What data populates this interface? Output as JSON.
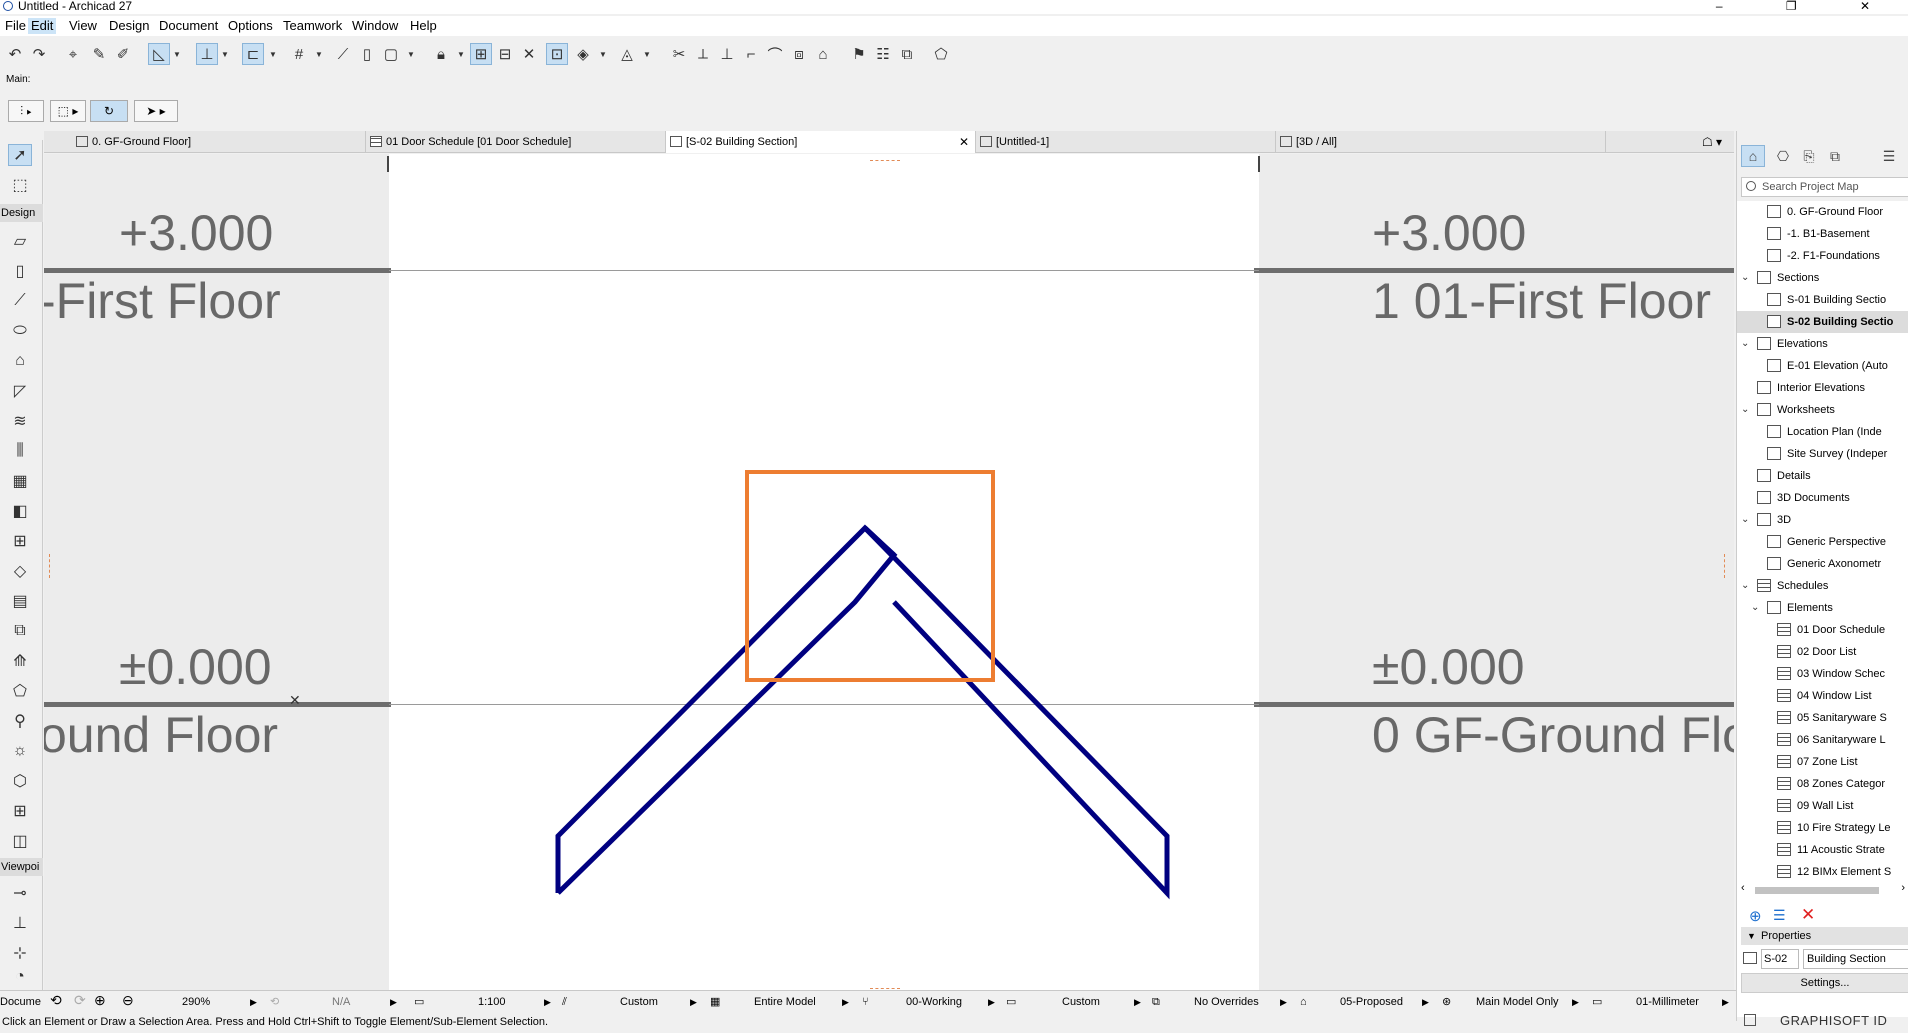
{
  "window": {
    "title": "Untitled - Archicad 27",
    "controls": "– ❐ ✕"
  },
  "menu": [
    "File",
    "Edit",
    "View",
    "Design",
    "Document",
    "Options",
    "Teamwork",
    "Window",
    "Help"
  ],
  "main_label": "Main:",
  "tabs": [
    {
      "label": "0. GF-Ground Floor]",
      "icon": "floorplan-icon"
    },
    {
      "label": "01 Door Schedule [01 Door Schedule]",
      "icon": "schedule-icon"
    },
    {
      "label": "[S-02 Building Section]",
      "icon": "section-icon",
      "close": "✕"
    },
    {
      "label": "[Untitled-1]",
      "icon": "layout-icon"
    },
    {
      "label": "[3D / All]",
      "icon": "3d-icon"
    }
  ],
  "left_toolbox": {
    "design_label": "Design",
    "viewpoint_label": "Viewpoi",
    "document_label": "Docume"
  },
  "canvas": {
    "levels_left": [
      {
        "elevation": "+3.000",
        "name": "-First Floor"
      },
      {
        "elevation": "±0.000",
        "name": "ound Floor"
      }
    ],
    "levels_right": [
      {
        "elevation": "+3.000",
        "name": "1 01-First Floor"
      },
      {
        "elevation": "±0.000",
        "name": "0 GF-Ground Flo"
      }
    ],
    "section_color": "#000080",
    "marquee_color": "#ed7d31"
  },
  "project_map": {
    "search_placeholder": "Search Project Map",
    "items": [
      {
        "label": "0. GF-Ground Floor",
        "level": 2,
        "icon": "story-icon"
      },
      {
        "label": "-1. B1-Basement",
        "level": 2,
        "icon": "story-icon"
      },
      {
        "label": "-2. F1-Foundations",
        "level": 2,
        "icon": "story-icon"
      },
      {
        "label": "Sections",
        "level": 1,
        "icon": "folder-icon",
        "chev": "v"
      },
      {
        "label": "S-01 Building Sectio",
        "level": 2,
        "icon": "section-icon"
      },
      {
        "label": "S-02 Building Sectio",
        "level": 2,
        "icon": "section-icon",
        "selected": true
      },
      {
        "label": "Elevations",
        "level": 1,
        "icon": "folder-icon",
        "chev": "v"
      },
      {
        "label": "E-01 Elevation (Auto",
        "level": 2,
        "icon": "elevation-icon"
      },
      {
        "label": "Interior Elevations",
        "level": 1,
        "icon": "interior-elevation-icon"
      },
      {
        "label": "Worksheets",
        "level": 1,
        "icon": "worksheet-icon",
        "chev": "v"
      },
      {
        "label": "Location Plan (Inde",
        "level": 2,
        "icon": "worksheet-icon"
      },
      {
        "label": "Site Survey (Indeper",
        "level": 2,
        "icon": "worksheet-icon"
      },
      {
        "label": "Details",
        "level": 1,
        "icon": "details-icon"
      },
      {
        "label": "3D Documents",
        "level": 1,
        "icon": "3d-document-icon"
      },
      {
        "label": "3D",
        "level": 1,
        "icon": "3d-icon",
        "chev": "v"
      },
      {
        "label": "Generic Perspective",
        "level": 2,
        "icon": "perspective-icon"
      },
      {
        "label": "Generic Axonometr",
        "level": 2,
        "icon": "axonometry-icon"
      },
      {
        "label": "Schedules",
        "level": 1,
        "icon": "schedule-icon",
        "chev": "v"
      },
      {
        "label": "Elements",
        "level": 2,
        "icon": "elements-icon",
        "chev": "v"
      },
      {
        "label": "01 Door Schedule",
        "level": 3,
        "icon": "schedule-icon"
      },
      {
        "label": "02 Door List",
        "level": 3,
        "icon": "schedule-icon"
      },
      {
        "label": "03 Window Schec",
        "level": 3,
        "icon": "schedule-icon"
      },
      {
        "label": "04 Window List",
        "level": 3,
        "icon": "schedule-icon"
      },
      {
        "label": "05 Sanitaryware S",
        "level": 3,
        "icon": "schedule-icon"
      },
      {
        "label": "06 Sanitaryware L",
        "level": 3,
        "icon": "schedule-icon"
      },
      {
        "label": "07 Zone List",
        "level": 3,
        "icon": "schedule-icon"
      },
      {
        "label": "08 Zones Categor",
        "level": 3,
        "icon": "schedule-icon"
      },
      {
        "label": "09 Wall List",
        "level": 3,
        "icon": "schedule-icon"
      },
      {
        "label": "10 Fire Strategy Le",
        "level": 3,
        "icon": "schedule-icon"
      },
      {
        "label": "11 Acoustic Strate",
        "level": 3,
        "icon": "schedule-icon"
      },
      {
        "label": "12 BIMx Element S",
        "level": 3,
        "icon": "schedule-icon"
      }
    ]
  },
  "properties": {
    "header": "Properties",
    "id": "S-02",
    "name": "Building Section",
    "settings": "Settings..."
  },
  "brand": "GRAPHISOFT ID",
  "statusbar": {
    "zoom": "290%",
    "angle": "N/A",
    "scale": "1:100",
    "layer_combo": "Custom",
    "model_view": "Entire Model",
    "pen_set": "00-Working",
    "dimension": "Custom",
    "overrides": "No Overrides",
    "renovation": "05-Proposed",
    "model_only": "Main Model Only",
    "units": "01-Millimeter"
  },
  "hint": "Click an Element or Draw a Selection Area. Press and Hold Ctrl+Shift to Toggle Element/Sub-Element Selection."
}
